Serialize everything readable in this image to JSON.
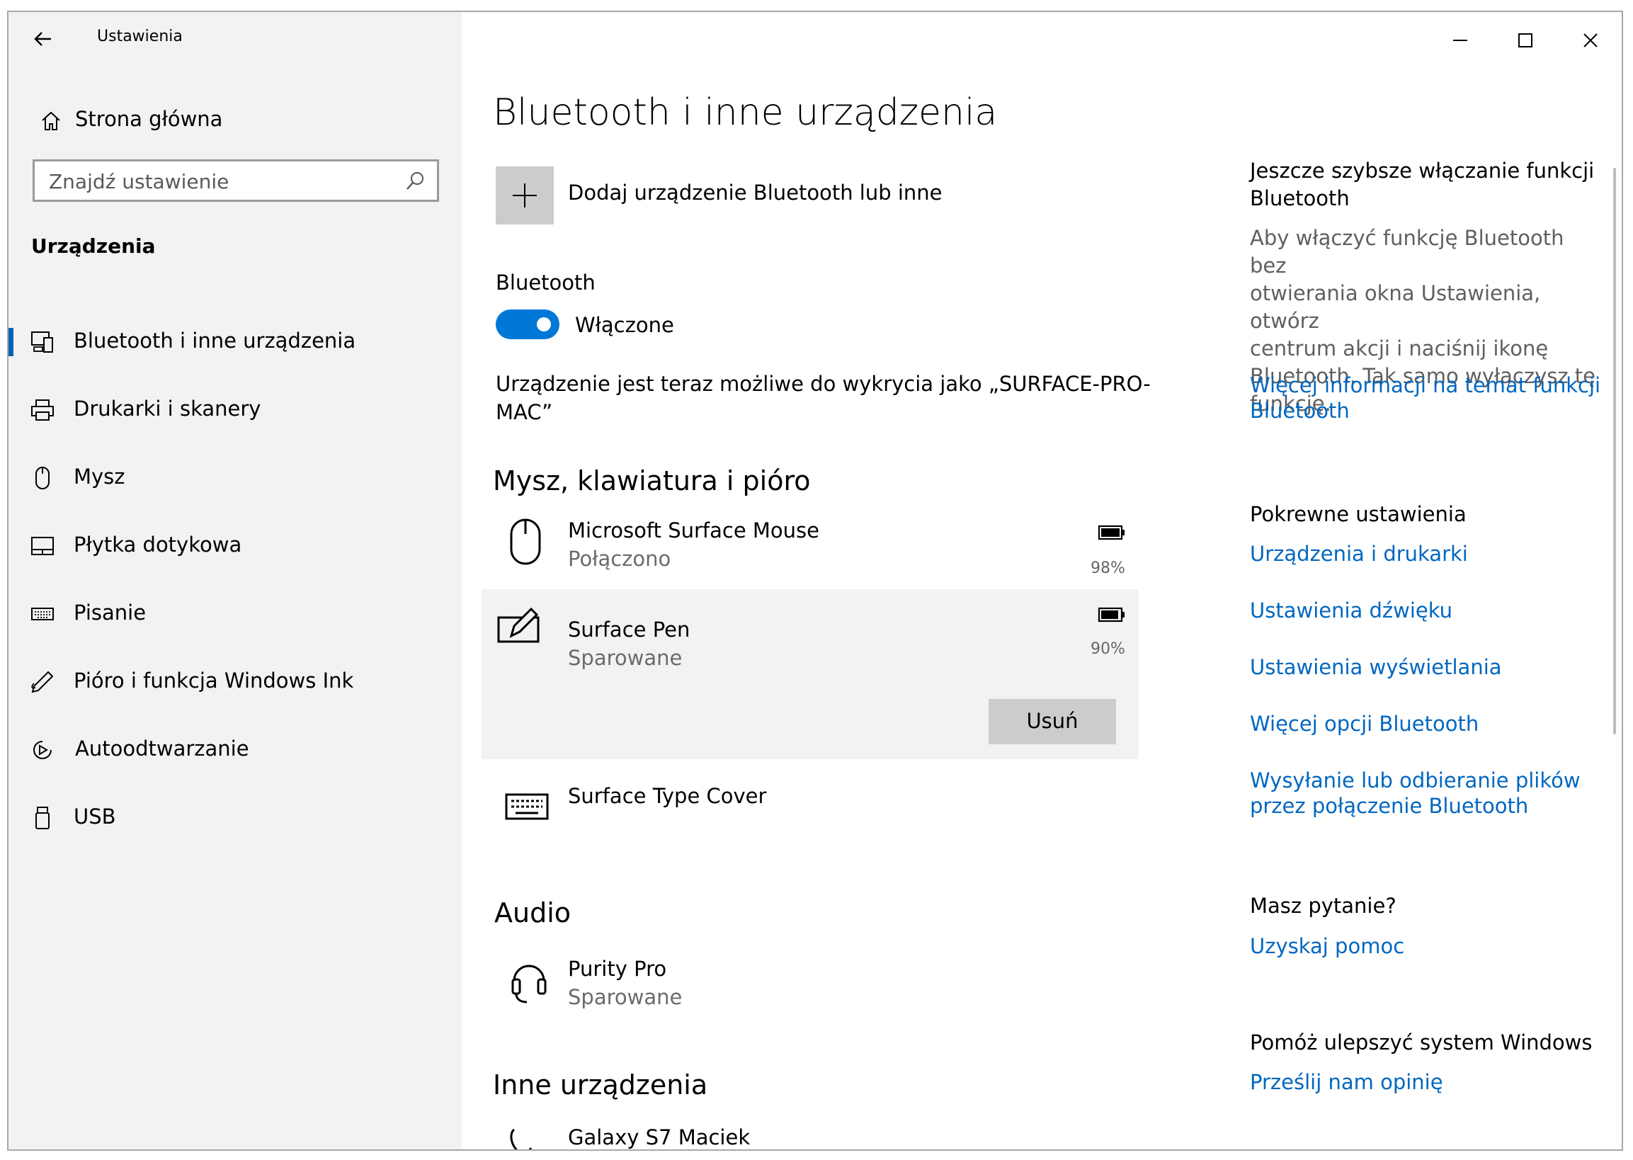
{
  "window": {
    "title": "Ustawienia"
  },
  "sidebar": {
    "home_label": "Strona główna",
    "search_placeholder": "Znajdź ustawienie",
    "section_title": "Urządzenia",
    "items": [
      {
        "label": "Bluetooth i inne urządzenia",
        "icon": "bluetooth-devices-icon",
        "selected": true
      },
      {
        "label": "Drukarki i skanery",
        "icon": "printer-icon"
      },
      {
        "label": "Mysz",
        "icon": "mouse-icon"
      },
      {
        "label": "Płytka dotykowa",
        "icon": "touchpad-icon"
      },
      {
        "label": "Pisanie",
        "icon": "keyboard-icon"
      },
      {
        "label": "Pióro i funkcja Windows Ink",
        "icon": "pen-icon"
      },
      {
        "label": "Autoodtwarzanie",
        "icon": "autoplay-icon"
      },
      {
        "label": "USB",
        "icon": "usb-icon"
      }
    ]
  },
  "main": {
    "title": "Bluetooth i inne urządzenia",
    "add_device_label": "Dodaj urządzenie Bluetooth lub inne",
    "bluetooth_label": "Bluetooth",
    "toggle_state": "Włączone",
    "discoverable_line1": "Urządzenie jest teraz możliwe do wykrycia jako „SURFACE-PRO-",
    "discoverable_line2": "MAC”",
    "section_input": "Mysz, klawiatura i pióro",
    "devices_input": [
      {
        "name": "Microsoft Surface Mouse",
        "status": "Połączono",
        "battery": "98%"
      },
      {
        "name": "Surface Pen",
        "status": "Sparowane",
        "battery": "90%",
        "action": "Usuń"
      },
      {
        "name": "Surface Type Cover",
        "status": ""
      }
    ],
    "section_audio": "Audio",
    "devices_audio": [
      {
        "name": "Purity Pro",
        "status": "Sparowane"
      }
    ],
    "section_other": "Inne urządzenia",
    "devices_other": [
      {
        "name": "Galaxy S7 Maciek"
      }
    ]
  },
  "right": {
    "tip_title_1": "Jeszcze szybsze włączanie funkcji",
    "tip_title_2": "Bluetooth",
    "tip_body": [
      "Aby włączyć funkcję Bluetooth bez",
      "otwierania okna Ustawienia, otwórz",
      "centrum akcji i naciśnij ikonę",
      "Bluetooth. Tak samo wyłączysz tę",
      "funkcję."
    ],
    "tip_link_1": "Więcej informacji na temat funkcji",
    "tip_link_2": "Bluetooth",
    "related_title": "Pokrewne ustawienia",
    "related_links": [
      "Urządzenia i drukarki",
      "Ustawienia dźwięku",
      "Ustawienia wyświetlania",
      "Więcej opcji Bluetooth"
    ],
    "related_link_long_1": "Wysyłanie lub odbieranie plików",
    "related_link_long_2": "przez połączenie Bluetooth",
    "question_title": "Masz pytanie?",
    "question_link": "Uzyskaj pomoc",
    "improve_title": "Pomóż ulepszyć system Windows",
    "improve_link": "Prześlij nam opinię"
  },
  "colors": {
    "accent": "#0067c0",
    "toggle": "#0078d7",
    "sidebar_bg": "#f2f2f2",
    "selected_row_bg": "#f2f2f2"
  }
}
